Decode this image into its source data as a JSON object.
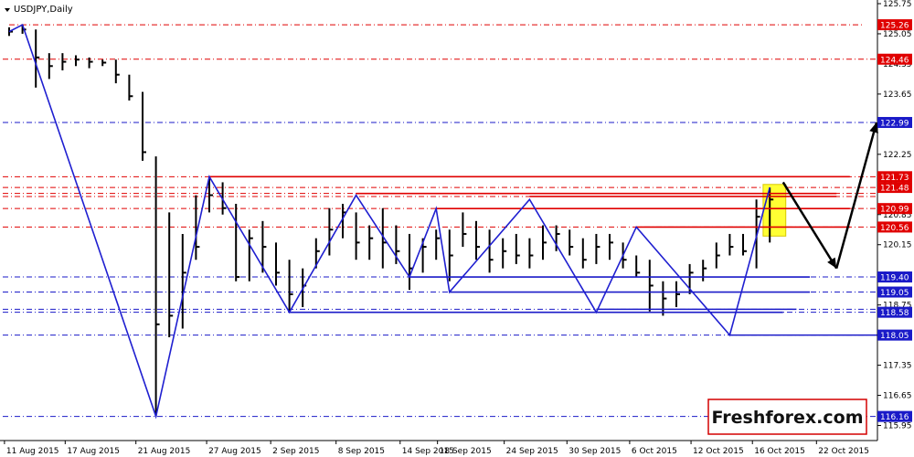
{
  "window": {
    "symbol_title": "USDJPY,Daily",
    "watermark": "Freshforex.com"
  },
  "colors": {
    "background": "#ffffff",
    "bars": "#000000",
    "zigzag": "#1f1fd0",
    "resistance": "#e00000",
    "support": "#1a1ac8",
    "highlight": "#ffff33",
    "forecast": "#000000",
    "grid": "#000000"
  },
  "chart_data": {
    "type": "line",
    "title": "USDJPY,Daily",
    "ylim": [
      115.6,
      125.75
    ],
    "y_axis_ticks": [
      "125.75",
      "125.05",
      "124.35",
      "123.65",
      "122.95",
      "122.25",
      "121.55",
      "120.85",
      "120.15",
      "119.45",
      "118.75",
      "118.05",
      "117.35",
      "116.65",
      "115.95"
    ],
    "x_axis_ticks": [
      "11 Aug 2015",
      "17 Aug 2015",
      "21 Aug 2015",
      "27 Aug 2015",
      "2 Sep 2015",
      "8 Sep 2015",
      "14 Sep 2015",
      "18 Sep 2015",
      "24 Sep 2015",
      "30 Sep 2015",
      "6 Oct 2015",
      "12 Oct 2015",
      "16 Oct 2015",
      "22 Oct 2015"
    ],
    "grid": false,
    "price_bars": [
      {
        "low": 125.0,
        "high": 125.2,
        "close": 125.1
      },
      {
        "low": 125.05,
        "high": 125.26,
        "close": 125.15
      },
      {
        "low": 123.8,
        "high": 125.15,
        "close": 124.5
      },
      {
        "low": 124.0,
        "high": 124.6,
        "close": 124.3
      },
      {
        "low": 124.2,
        "high": 124.6,
        "close": 124.4
      },
      {
        "low": 124.3,
        "high": 124.55,
        "close": 124.45
      },
      {
        "low": 124.25,
        "high": 124.5,
        "close": 124.4
      },
      {
        "low": 124.3,
        "high": 124.45,
        "close": 124.38
      },
      {
        "low": 123.9,
        "high": 124.45,
        "close": 124.1
      },
      {
        "low": 123.5,
        "high": 124.1,
        "close": 123.6
      },
      {
        "low": 122.1,
        "high": 123.7,
        "close": 122.3
      },
      {
        "low": 116.16,
        "high": 122.2,
        "close": 118.3
      },
      {
        "low": 118.0,
        "high": 120.9,
        "close": 118.5
      },
      {
        "low": 118.2,
        "high": 120.4,
        "close": 119.5
      },
      {
        "low": 119.8,
        "high": 121.3,
        "close": 120.1
      },
      {
        "low": 120.9,
        "high": 121.73,
        "close": 121.3
      },
      {
        "low": 120.85,
        "high": 121.6,
        "close": 121.0
      },
      {
        "low": 119.3,
        "high": 121.1,
        "close": 119.4
      },
      {
        "low": 119.3,
        "high": 120.5,
        "close": 120.3
      },
      {
        "low": 119.5,
        "high": 120.7,
        "close": 120.1
      },
      {
        "low": 119.2,
        "high": 120.2,
        "close": 119.5
      },
      {
        "low": 118.6,
        "high": 119.8,
        "close": 119.0
      },
      {
        "low": 118.7,
        "high": 119.6,
        "close": 119.2
      },
      {
        "low": 119.6,
        "high": 120.3,
        "close": 120.0
      },
      {
        "low": 119.9,
        "high": 121.0,
        "close": 120.5
      },
      {
        "low": 120.3,
        "high": 121.1,
        "close": 120.9
      },
      {
        "low": 119.8,
        "high": 120.9,
        "close": 120.2
      },
      {
        "low": 119.8,
        "high": 120.6,
        "close": 120.3
      },
      {
        "low": 119.6,
        "high": 121.0,
        "close": 120.2
      },
      {
        "low": 119.7,
        "high": 120.6,
        "close": 120.0
      },
      {
        "low": 119.1,
        "high": 120.4,
        "close": 119.6
      },
      {
        "low": 119.5,
        "high": 120.3,
        "close": 120.1
      },
      {
        "low": 119.8,
        "high": 120.5,
        "close": 120.3
      },
      {
        "low": 119.3,
        "high": 120.5,
        "close": 119.9
      },
      {
        "low": 120.1,
        "high": 120.9,
        "close": 120.4
      },
      {
        "low": 119.8,
        "high": 120.7,
        "close": 120.1
      },
      {
        "low": 119.5,
        "high": 120.5,
        "close": 119.8
      },
      {
        "low": 119.6,
        "high": 120.3,
        "close": 120.0
      },
      {
        "low": 119.7,
        "high": 120.4,
        "close": 119.9
      },
      {
        "low": 119.6,
        "high": 120.3,
        "close": 119.9
      },
      {
        "low": 119.8,
        "high": 120.6,
        "close": 120.2
      },
      {
        "low": 120.0,
        "high": 120.6,
        "close": 120.4
      },
      {
        "low": 119.9,
        "high": 120.5,
        "close": 120.1
      },
      {
        "low": 119.6,
        "high": 120.3,
        "close": 119.8
      },
      {
        "low": 119.7,
        "high": 120.4,
        "close": 120.1
      },
      {
        "low": 119.8,
        "high": 120.4,
        "close": 120.2
      },
      {
        "low": 119.6,
        "high": 120.2,
        "close": 119.8
      },
      {
        "low": 119.4,
        "high": 119.9,
        "close": 119.5
      },
      {
        "low": 118.6,
        "high": 119.8,
        "close": 119.2
      },
      {
        "low": 118.5,
        "high": 119.3,
        "close": 118.9
      },
      {
        "low": 118.7,
        "high": 119.3,
        "close": 119.0
      },
      {
        "low": 119.0,
        "high": 119.7,
        "close": 119.5
      },
      {
        "low": 119.3,
        "high": 119.8,
        "close": 119.6
      },
      {
        "low": 119.6,
        "high": 120.2,
        "close": 119.9
      },
      {
        "low": 119.9,
        "high": 120.4,
        "close": 120.1
      },
      {
        "low": 119.9,
        "high": 120.4,
        "close": 120.0
      },
      {
        "low": 119.6,
        "high": 121.2,
        "close": 120.8
      },
      {
        "low": 120.2,
        "high": 121.48,
        "close": 121.2
      }
    ],
    "zigzag": [
      {
        "bar": 0,
        "price": 125.1
      },
      {
        "bar": 1,
        "price": 125.26
      },
      {
        "bar": 11,
        "price": 116.16
      },
      {
        "bar": 15,
        "price": 121.73
      },
      {
        "bar": 21,
        "price": 118.58
      },
      {
        "bar": 26,
        "price": 121.3
      },
      {
        "bar": 30,
        "price": 119.4
      },
      {
        "bar": 32,
        "price": 120.99
      },
      {
        "bar": 33,
        "price": 119.05
      },
      {
        "bar": 39,
        "price": 121.2
      },
      {
        "bar": 44,
        "price": 118.58
      },
      {
        "bar": 47,
        "price": 120.56
      },
      {
        "bar": 54,
        "price": 118.05
      },
      {
        "bar": 57,
        "price": 121.48
      }
    ],
    "horizontal_levels": [
      {
        "price": 125.26,
        "style": "dashdot",
        "color": "red",
        "from_bar": 0,
        "to_bar": 64
      },
      {
        "price": 124.46,
        "style": "dashdot",
        "color": "red",
        "from_bar": -2,
        "to_bar": 70
      },
      {
        "price": 122.99,
        "style": "dashdot",
        "color": "blue",
        "from_bar": -2,
        "to_bar": 70
      },
      {
        "price": 121.73,
        "style": "dashdot",
        "color": "red",
        "from_bar": -2,
        "to_bar": 70
      },
      {
        "price": 121.48,
        "style": "dashdot",
        "color": "red",
        "from_bar": -2,
        "to_bar": 70
      },
      {
        "price": 121.34,
        "style": "dashdot",
        "color": "red",
        "from_bar": -2,
        "to_bar": 70
      },
      {
        "price": 121.27,
        "style": "dashdot",
        "color": "red",
        "from_bar": -2,
        "to_bar": 70
      },
      {
        "price": 120.99,
        "style": "dashdot",
        "color": "red",
        "from_bar": -2,
        "to_bar": 70
      },
      {
        "price": 120.56,
        "style": "dashdot",
        "color": "red",
        "from_bar": -2,
        "to_bar": 70
      },
      {
        "price": 119.4,
        "style": "dashdot",
        "color": "blue",
        "from_bar": -2,
        "to_bar": 70
      },
      {
        "price": 119.05,
        "style": "dashdot",
        "color": "blue",
        "from_bar": -2,
        "to_bar": 70
      },
      {
        "price": 118.65,
        "style": "dashdot",
        "color": "blue",
        "from_bar": -2,
        "to_bar": 70
      },
      {
        "price": 118.58,
        "style": "dashdot",
        "color": "blue",
        "from_bar": -2,
        "to_bar": 70
      },
      {
        "price": 118.05,
        "style": "dashdot",
        "color": "blue",
        "from_bar": -2,
        "to_bar": 70
      },
      {
        "price": 116.16,
        "style": "dashdot",
        "color": "blue",
        "from_bar": -2,
        "to_bar": 70
      }
    ],
    "trend_lines": [
      {
        "price": 121.73,
        "from_bar": 15,
        "to_bar": 63,
        "color": "red"
      },
      {
        "price": 121.34,
        "from_bar": 26,
        "to_bar": 62,
        "color": "red"
      },
      {
        "price": 121.27,
        "from_bar": 39,
        "to_bar": 62,
        "color": "red"
      },
      {
        "price": 120.99,
        "from_bar": 32,
        "to_bar": 63,
        "color": "red"
      },
      {
        "price": 120.56,
        "from_bar": 47,
        "to_bar": 63,
        "color": "red"
      },
      {
        "price": 119.4,
        "from_bar": 30,
        "to_bar": 60,
        "color": "blue"
      },
      {
        "price": 119.05,
        "from_bar": 33,
        "to_bar": 60,
        "color": "blue"
      },
      {
        "price": 118.65,
        "from_bar": 44,
        "to_bar": 59,
        "color": "blue"
      },
      {
        "price": 118.58,
        "from_bar": 21,
        "to_bar": 58,
        "color": "blue"
      },
      {
        "price": 118.05,
        "from_bar": 54,
        "to_bar": 70,
        "color": "blue"
      }
    ],
    "price_tags": [
      {
        "label": "125.26",
        "price": 125.26,
        "color": "red"
      },
      {
        "label": "124.46",
        "price": 124.46,
        "color": "red"
      },
      {
        "label": "122.99",
        "price": 122.99,
        "color": "blue"
      },
      {
        "label": "121.73",
        "price": 121.73,
        "color": "red"
      },
      {
        "label": "121.48",
        "price": 121.48,
        "color": "red"
      },
      {
        "label": "120.99",
        "price": 120.99,
        "color": "red"
      },
      {
        "label": "120.56",
        "price": 120.56,
        "color": "red"
      },
      {
        "label": "119.40",
        "price": 119.4,
        "color": "blue"
      },
      {
        "label": "119.05",
        "price": 119.05,
        "color": "blue"
      },
      {
        "label": "118.58",
        "price": 118.58,
        "color": "blue"
      },
      {
        "label": "118.05",
        "price": 118.05,
        "color": "blue"
      },
      {
        "label": "116.16",
        "price": 116.16,
        "color": "blue"
      }
    ],
    "forecast_path": [
      {
        "bar": 58,
        "price": 121.6
      },
      {
        "bar": 62,
        "price": 119.6
      },
      {
        "bar": 65,
        "price": 122.99
      }
    ],
    "highlight_zone": {
      "from_bar": 56.5,
      "to_bar": 58.2,
      "price_low": 120.35,
      "price_high": 121.55
    }
  }
}
